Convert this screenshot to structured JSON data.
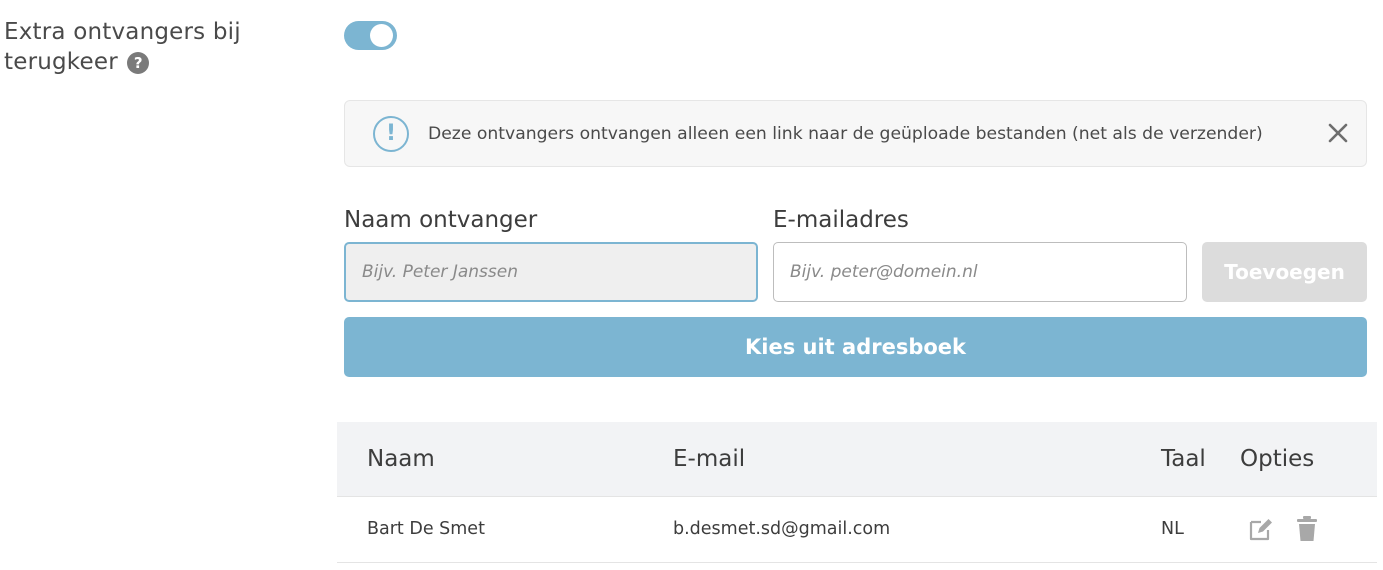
{
  "setting": {
    "label": "Extra ontvangers bij terugkeer",
    "help_icon": "question-circle-icon",
    "toggle_on": true,
    "accent_color": "#7cb5d2"
  },
  "info": {
    "text": "Deze ontvangers ontvangen alleen een link naar de geüploade bestanden (net als de verzender)",
    "icon": "exclamation-circle-icon",
    "close_icon": "close-icon"
  },
  "form": {
    "name_label": "Naam ontvanger",
    "name_placeholder": "Bijv. Peter Janssen",
    "name_value": "",
    "email_label": "E-mailadres",
    "email_placeholder": "Bijv. peter@domein.nl",
    "email_value": "",
    "add_button": "Toevoegen",
    "addressbook_button": "Kies uit adresboek"
  },
  "table": {
    "headers": {
      "name": "Naam",
      "email": "E-mail",
      "lang": "Taal",
      "options": "Opties"
    },
    "rows": [
      {
        "name": "Bart De Smet",
        "email": "b.desmet.sd@gmail.com",
        "lang": "NL",
        "edit_icon": "edit-icon",
        "delete_icon": "trash-icon"
      }
    ]
  }
}
